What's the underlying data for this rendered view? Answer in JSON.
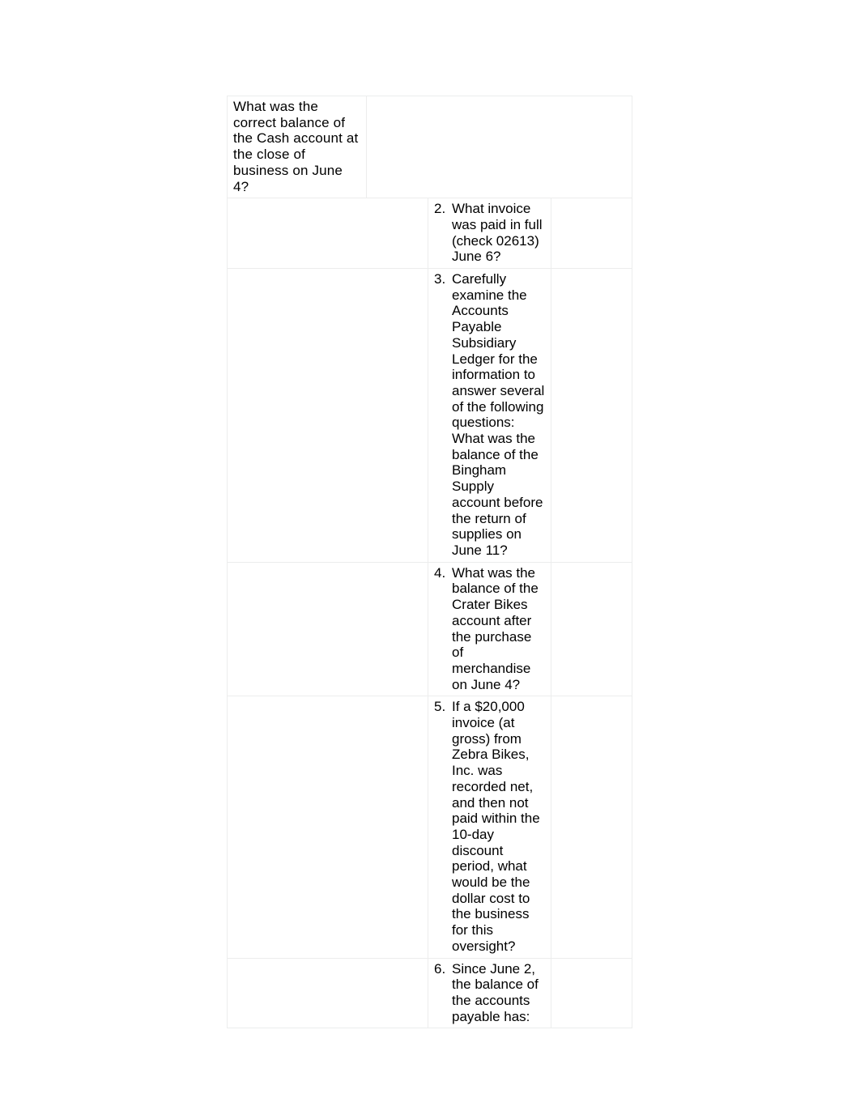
{
  "document": {
    "title": "Accounting Review Questions",
    "background_color": "#ffffff",
    "text_color": "#000000",
    "border_color": "#eceded"
  },
  "table": {
    "rows": [
      {
        "id": "row-1",
        "first_cell_text": "What was the correct balance of the Cash account at the close of business on June 4?",
        "number": "",
        "question": "",
        "trailing_cell": ""
      },
      {
        "id": "row-2",
        "first_cell_text": "",
        "number": "2.",
        "question": "What invoice was paid in full (check 02613) June 6?",
        "trailing_cell": ""
      },
      {
        "id": "row-3",
        "first_cell_text": "",
        "number": "3.",
        "question": "Carefully examine the Accounts Payable Subsidiary Ledger for the information to answer several of the following questions: What was the balance of the Bingham Supply account before the return of supplies on June 11?",
        "trailing_cell": ""
      },
      {
        "id": "row-4",
        "first_cell_text": "",
        "number": "4.",
        "question": "What was the balance of the Crater Bikes account after the purchase of merchandise on June 4?",
        "trailing_cell": ""
      },
      {
        "id": "row-5",
        "first_cell_text": "",
        "number": "5.",
        "question": "If a $20,000 invoice (at gross) from Zebra Bikes, Inc. was recorded net, and then not paid within the 10-day discount period, what would be the dollar cost to the business for this oversight?",
        "trailing_cell": ""
      },
      {
        "id": "row-6",
        "first_cell_text": "",
        "number": "6.",
        "question": "Since June 2, the balance of the accounts payable has:",
        "trailing_cell": ""
      }
    ]
  }
}
